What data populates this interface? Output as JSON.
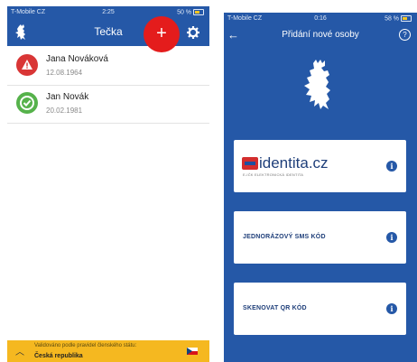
{
  "left": {
    "status": {
      "carrier": "T-Mobile CZ",
      "time": "2:25",
      "battery": "50 %"
    },
    "title": "Tečka",
    "add_label": "+",
    "people": [
      {
        "name": "Jana Nováková",
        "date": "12.08.1964",
        "status": "warning"
      },
      {
        "name": "Jan Novák",
        "date": "20.02.1981",
        "status": "valid"
      }
    ],
    "bottom": {
      "line1": "Validováno podle pravidel členského státu:",
      "line2": "Česká republika"
    },
    "colors": {
      "bar": "#2558a7",
      "warning": "#d93636",
      "valid": "#56b24b",
      "footer": "#f5b820",
      "highlight": "#e41c1c"
    }
  },
  "right": {
    "status": {
      "carrier": "T-Mobile CZ",
      "time": "0:16",
      "battery": "58 %"
    },
    "title": "Přidání nové osoby",
    "help": "?",
    "identita": {
      "brand": "identita.cz",
      "sub": "E-IČK ELEKTRONICKÁ IDENTITA"
    },
    "options": [
      {
        "label": "JEDNORÁZOVÝ SMS KÓD"
      },
      {
        "label": "SKENOVAT QR KÓD"
      }
    ],
    "info_icon": "i"
  }
}
